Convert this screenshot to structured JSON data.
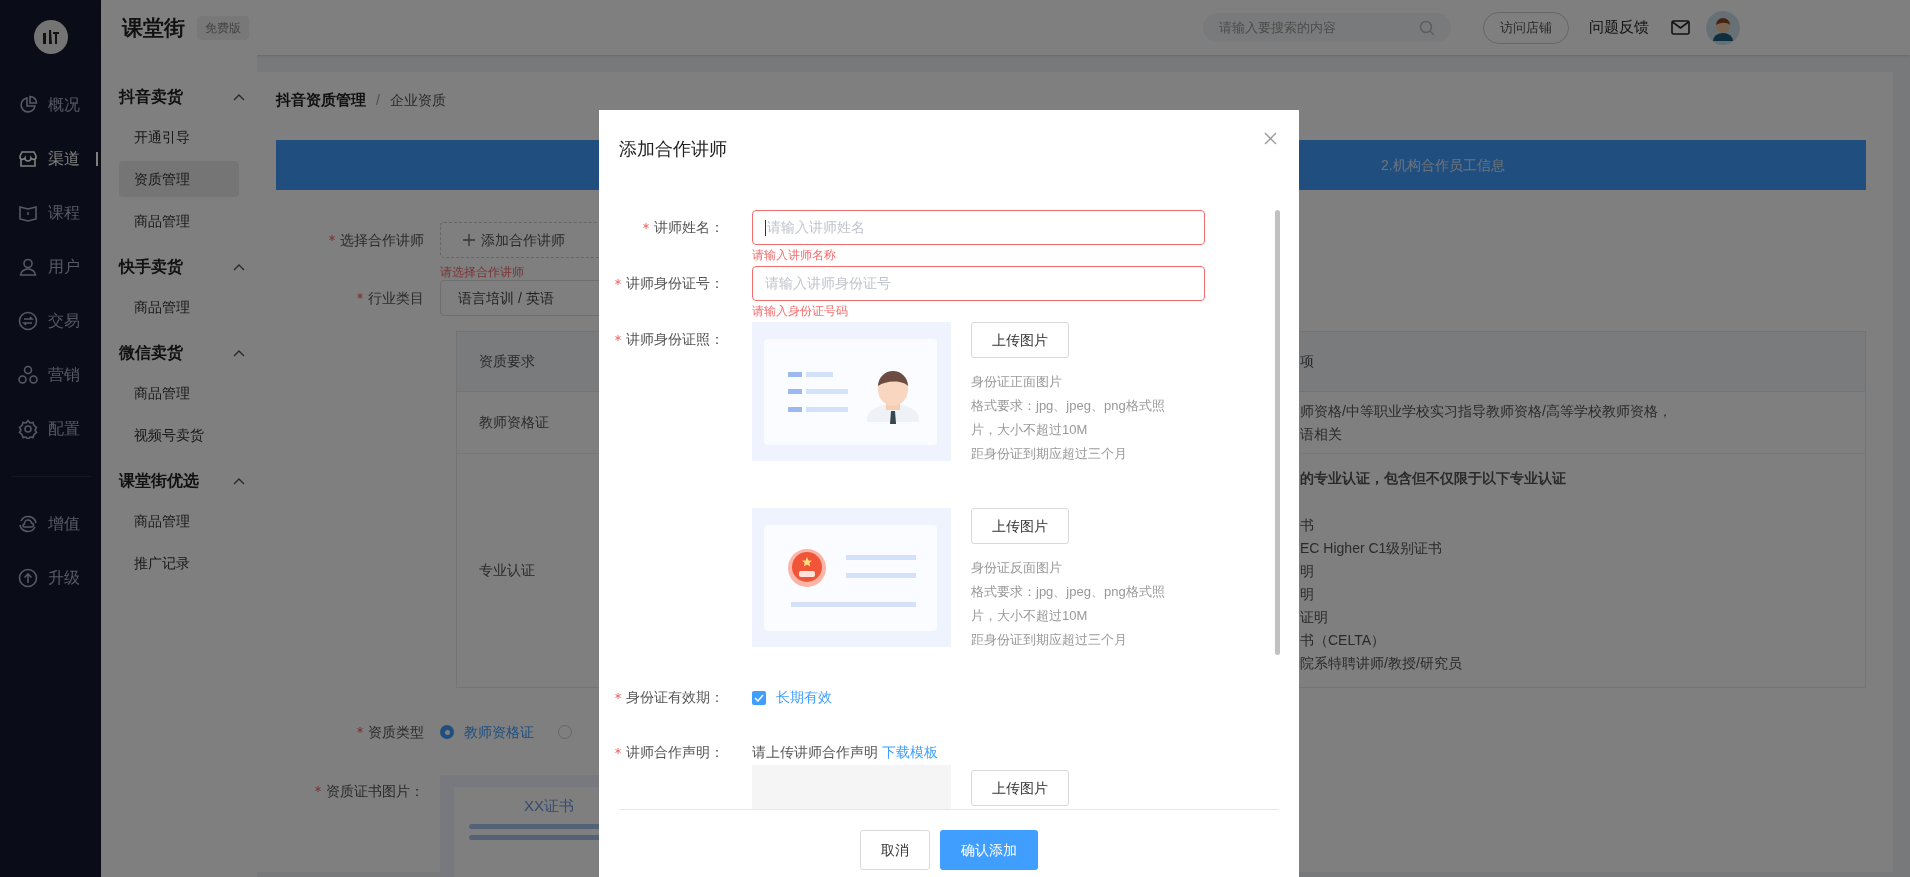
{
  "app": {
    "title": "课堂街",
    "badge": "免费版"
  },
  "nav": [
    {
      "label": "概况",
      "selected": false
    },
    {
      "label": "渠道",
      "selected": true
    },
    {
      "label": "课程",
      "selected": false
    },
    {
      "label": "用户",
      "selected": false
    },
    {
      "label": "交易",
      "selected": false
    },
    {
      "label": "营销",
      "selected": false
    },
    {
      "label": "配置",
      "selected": false
    }
  ],
  "nav_extra": [
    {
      "label": "增值",
      "selected": false
    },
    {
      "label": "升级",
      "selected": false
    }
  ],
  "topbar": {
    "search_placeholder": "请输入要搜索的内容",
    "visit_button": "访问店铺",
    "feedback_link": "问题反馈"
  },
  "submenu": [
    {
      "title": "抖音卖货",
      "expanded": true,
      "items": [
        {
          "label": "开通引导",
          "selected": false
        },
        {
          "label": "资质管理",
          "selected": true
        },
        {
          "label": "商品管理",
          "selected": false
        }
      ]
    },
    {
      "title": "快手卖货",
      "expanded": true,
      "items": [
        {
          "label": "商品管理",
          "selected": false
        }
      ]
    },
    {
      "title": "微信卖货",
      "expanded": true,
      "items": [
        {
          "label": "商品管理",
          "selected": false
        },
        {
          "label": "视频号卖货",
          "selected": false
        }
      ]
    },
    {
      "title": "课堂街优选",
      "expanded": true,
      "items": [
        {
          "label": "商品管理",
          "selected": false
        },
        {
          "label": "推广记录",
          "selected": false
        }
      ]
    }
  ],
  "breadcrumb": [
    "抖音资质管理",
    "企业资质"
  ],
  "breadcrumb_separator": "/",
  "step_label": "2.机构合作员工信息",
  "form": {
    "teacher": {
      "label": "选择合作讲师",
      "required": true,
      "button": "添加合作讲师",
      "error": "请选择合作讲师"
    },
    "industry": {
      "label": "行业类目",
      "required": true,
      "value": "语言培训 / 英语"
    },
    "table": {
      "columns": [
        "资质要求",
        "项"
      ],
      "rows": [
        {
          "name": "教师资格证",
          "lines": [
            {
              "text": "师资格/中等职业学校实习指导教师资格/高等学校教师资格，",
              "bold": false
            },
            {
              "text": "语相关",
              "bold": false
            }
          ]
        },
        {
          "name": "专业认证",
          "lines": [
            {
              "text": "的专业认证，包含但不仅限于以下专业认证",
              "bold": true
            },
            {
              "text": "书",
              "bold": false
            },
            {
              "text": "EC Higher C1级别证书",
              "bold": false
            },
            {
              "text": "明",
              "bold": false
            },
            {
              "text": "明",
              "bold": false
            },
            {
              "text": "证明",
              "bold": false
            },
            {
              "text": "书（CELTA）",
              "bold": false
            },
            {
              "text": "院系特聘讲师/教授/研究员",
              "bold": false
            }
          ]
        }
      ]
    },
    "type": {
      "label": "资质类型",
      "required": true,
      "options": [
        {
          "label": "教师资格证",
          "selected": true
        },
        {
          "selected": false
        }
      ]
    },
    "certificate": {
      "label": "资质证书图片：",
      "required": true,
      "sample_title": "XX证书"
    }
  },
  "dialog": {
    "title": "添加合作讲师",
    "fields": [
      {
        "kind": "input",
        "label": "讲师姓名：",
        "required": true,
        "placeholder": "请输入讲师姓名",
        "focused": true,
        "error": "请输入讲师名称"
      },
      {
        "kind": "input",
        "label": "讲师身份证号：",
        "required": true,
        "placeholder": "请输入讲师身份证号",
        "focused": false,
        "error": "请输入身份证号码"
      },
      {
        "kind": "photos",
        "label": "讲师身份证照：",
        "required": true,
        "uploads": [
          {
            "kind": "front",
            "button": "上传图片",
            "notes": [
              "身份证正面图片",
              "格式要求：jpg、jpeg、png格式照片，大小不超过10M",
              "距身份证到期应超过三个月"
            ]
          },
          {
            "kind": "back",
            "button": "上传图片",
            "notes": [
              "身份证反面图片",
              "格式要求：jpg、jpeg、png格式照片，大小不超过10M",
              "距身份证到期应超过三个月"
            ]
          }
        ]
      },
      {
        "kind": "checkbox",
        "label": "身份证有效期：",
        "required": true,
        "option": "长期有效",
        "checked": true
      },
      {
        "kind": "statement",
        "label": "讲师合作声明：",
        "required": true,
        "text": "请上传讲师合作声明",
        "link": "下载模板",
        "button": "上传图片"
      }
    ],
    "buttons": [
      {
        "label": "取消",
        "primary": false
      },
      {
        "label": "确认添加",
        "primary": true
      }
    ]
  }
}
